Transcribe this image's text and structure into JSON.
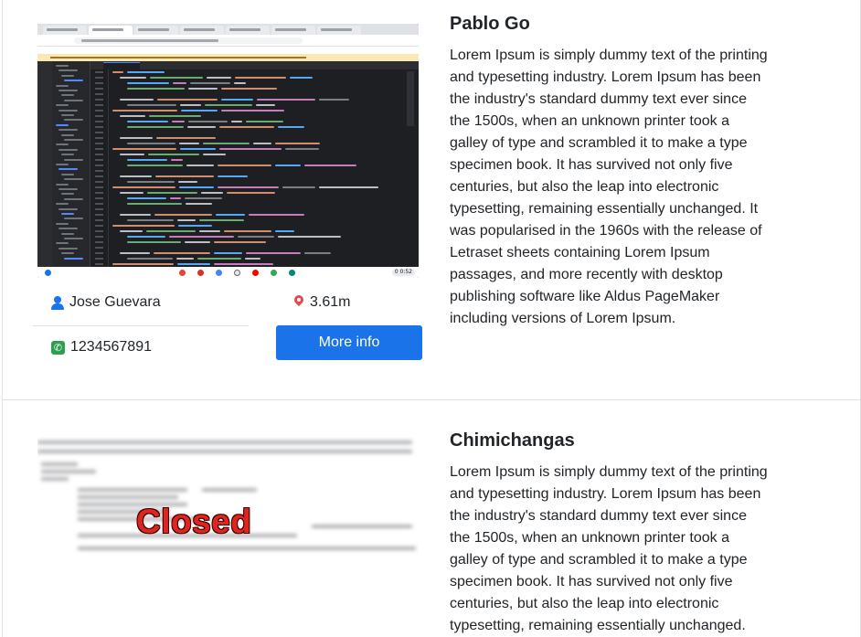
{
  "listings": [
    {
      "title": "Pablo Go",
      "owner": "Jose Guevara",
      "distance": "3.61m",
      "phone": "1234567891",
      "button_label": "More info",
      "description": "Lorem Ipsum is simply dummy text of the printing and typesetting industry. Lorem Ipsum has been the industry's standard dummy text ever since the 1500s, when an unknown printer took a galley of type and scrambled it to make a type specimen book. It has survived not only five centuries, but also the leap into electronic typesetting, remaining essentially unchanged. It was popularised in the 1960s with the release of Letraset sheets containing Lorem Ipsum passages, and more recently with desktop publishing software like Aldus PageMaker including versions of Lorem Ipsum.",
      "thumbnail_clock": "0 0:52"
    },
    {
      "title": "Chimichangas",
      "status_overlay": "Closed",
      "description": "Lorem Ipsum is simply dummy text of the printing and typesetting industry. Lorem Ipsum has been the industry's standard dummy text ever since the 1500s, when an unknown printer took a galley of type and scrambled it to make a type specimen book. It has survived not only five centuries, but also the leap into electronic typesetting, remaining essentially unchanged."
    }
  ],
  "colors": {
    "accent": "#1a73e8",
    "closed_red": "#e0251f",
    "phone_green": "#2e9e4f",
    "pin_red": "#e5484d"
  },
  "icons": {
    "owner": "user-icon",
    "distance": "map-pin-icon",
    "phone": "phone-icon"
  }
}
